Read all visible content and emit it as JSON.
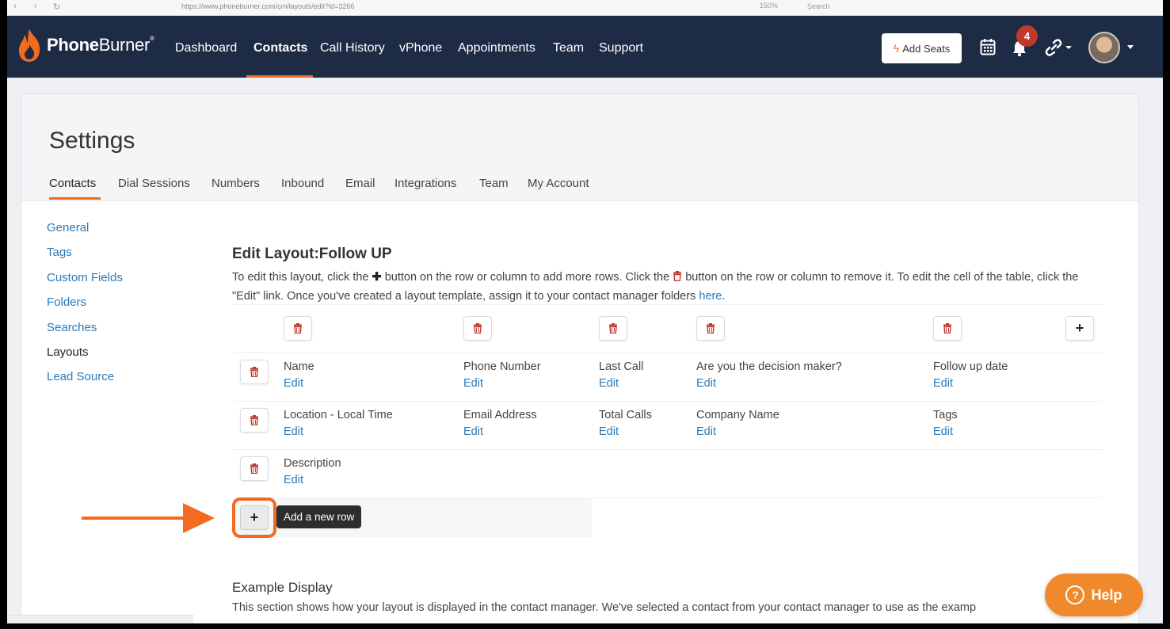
{
  "browser": {
    "url": "https://www.phoneburner.com/cm/layouts/edit?id=3266",
    "search_placeholder": "Search",
    "zoom": "150%"
  },
  "brand": {
    "bold": "Phone",
    "light": "Burner",
    "mark": "®"
  },
  "nav": {
    "items": [
      "Dashboard",
      "Contacts",
      "Call History",
      "vPhone",
      "Appointments",
      "Team",
      "Support"
    ],
    "active": "Contacts",
    "add_seats_label": "Add Seats",
    "notification_count": "4"
  },
  "settings": {
    "title": "Settings",
    "tabs": [
      "Contacts",
      "Dial Sessions",
      "Numbers",
      "Inbound",
      "Email",
      "Integrations",
      "Team",
      "My Account"
    ],
    "active_tab": "Contacts"
  },
  "sidebar": {
    "items": [
      "General",
      "Tags",
      "Custom Fields",
      "Folders",
      "Searches",
      "Layouts",
      "Lead Source"
    ],
    "current": "Layouts"
  },
  "layout": {
    "title": "Edit Layout:Follow UP",
    "intro_part1": "To edit this layout, click the",
    "intro_part2": "button on the row or column to add more rows. Click the",
    "intro_part3": "button on the row or column to remove it. To edit the cell of the table, click the \"Edit\" link. Once you've created a layout template, assign it to your contact manager folders",
    "intro_link": "here",
    "intro_end": ".",
    "edit_label": "Edit",
    "rows": [
      [
        "Name",
        "Phone Number",
        "Last Call",
        "Are you the decision maker?",
        "Follow up date"
      ],
      [
        "Location - Local Time",
        "Email Address",
        "Total Calls",
        "Company Name",
        "Tags"
      ],
      [
        "Description"
      ]
    ],
    "add_row_tooltip": "Add a new row"
  },
  "example": {
    "title": "Example Display",
    "description": "This section shows how your layout is displayed in the contact manager. We've selected a contact from your contact manager to use as the examp"
  },
  "help": {
    "label": "Help"
  },
  "colors": {
    "accent": "#f26b21",
    "nav_bg": "#1d2b45",
    "link": "#2a7ab8",
    "danger": "#c0392b"
  }
}
